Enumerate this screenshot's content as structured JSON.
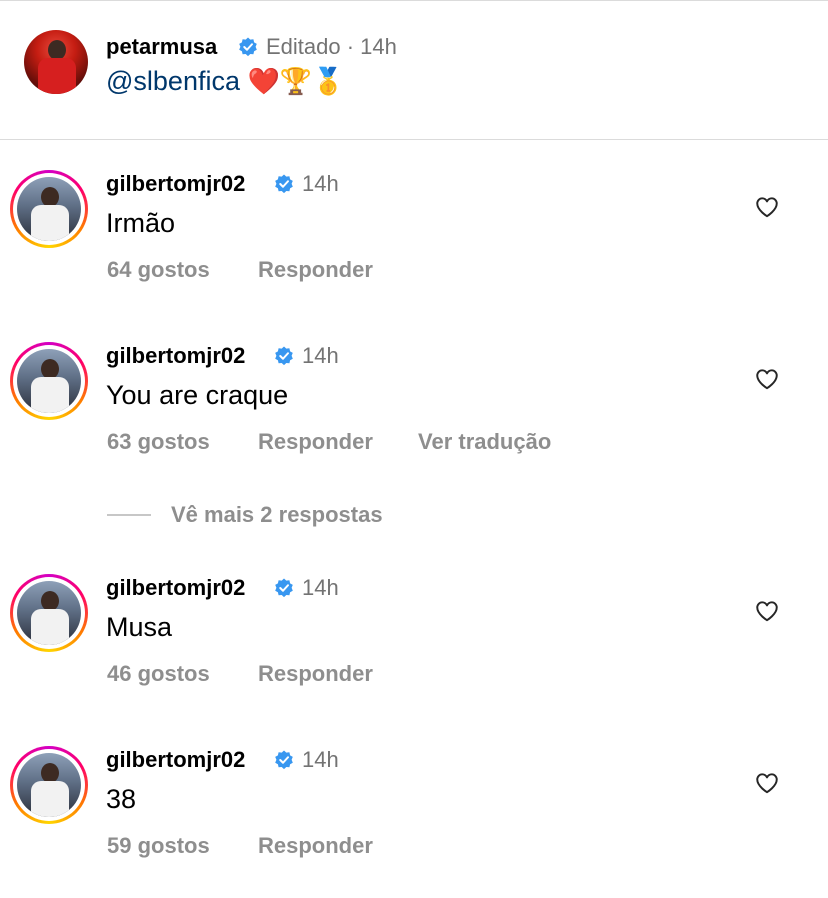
{
  "post": {
    "username": "petarmusa",
    "meta": "Editado · 14h",
    "mention": "@slbenfica",
    "emojis": "❤️🏆🥇"
  },
  "comments": [
    {
      "username": "gilbertomjr02",
      "time": "14h",
      "text": "Irmão",
      "likes": "64 gostos",
      "reply": "Responder",
      "translate": ""
    },
    {
      "username": "gilbertomjr02",
      "time": "14h",
      "text": "You are craque",
      "likes": "63 gostos",
      "reply": "Responder",
      "translate": "Ver tradução"
    },
    {
      "username": "gilbertomjr02",
      "time": "14h",
      "text": "Musa",
      "likes": "46 gostos",
      "reply": "Responder",
      "translate": ""
    },
    {
      "username": "gilbertomjr02",
      "time": "14h",
      "text": "38",
      "likes": "59 gostos",
      "reply": "Responder",
      "translate": ""
    }
  ],
  "more_replies": "Vê mais 2 respostas",
  "colors": {
    "verified": "#3897f0",
    "mention": "#00376b",
    "secondary": "#8e8e8e"
  },
  "icons": {
    "verified": "verified-badge-icon",
    "heart": "heart-outline-icon"
  }
}
